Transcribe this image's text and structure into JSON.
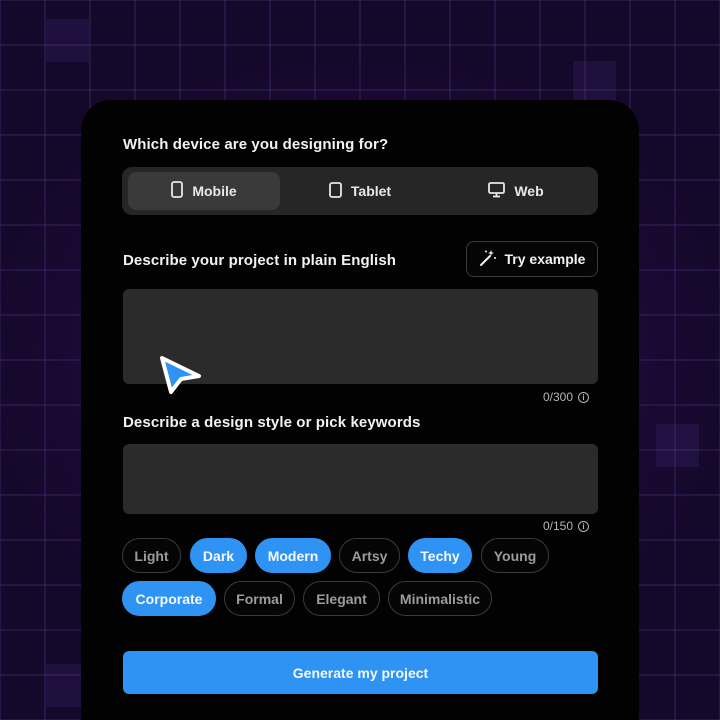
{
  "device_section": {
    "label": "Which device are you designing for?",
    "options": [
      {
        "label": "Mobile",
        "icon": "phone-icon",
        "active": true
      },
      {
        "label": "Tablet",
        "icon": "tablet-icon",
        "active": false
      },
      {
        "label": "Web",
        "icon": "monitor-icon",
        "active": false
      }
    ]
  },
  "project_section": {
    "label": "Describe your project in plain English",
    "try_example_label": "Try example",
    "try_example_icon": "magic-wand-icon",
    "value": "",
    "counter": "0/300"
  },
  "style_section": {
    "label": "Describe a design style or pick keywords",
    "value": "",
    "counter": "0/150",
    "keywords": [
      {
        "label": "Light",
        "selected": false
      },
      {
        "label": "Dark",
        "selected": true
      },
      {
        "label": "Modern",
        "selected": true
      },
      {
        "label": "Artsy",
        "selected": false
      },
      {
        "label": "Techy",
        "selected": true
      },
      {
        "label": "Young",
        "selected": false
      },
      {
        "label": "Corporate",
        "selected": true
      },
      {
        "label": "Formal",
        "selected": false
      },
      {
        "label": "Elegant",
        "selected": false
      },
      {
        "label": "Minimalistic",
        "selected": false
      }
    ]
  },
  "generate_label": "Generate my project",
  "colors": {
    "accent": "#2f93f3",
    "card_background": "#020202",
    "field_background": "#2b2b2b",
    "page_background": "#15082a"
  }
}
